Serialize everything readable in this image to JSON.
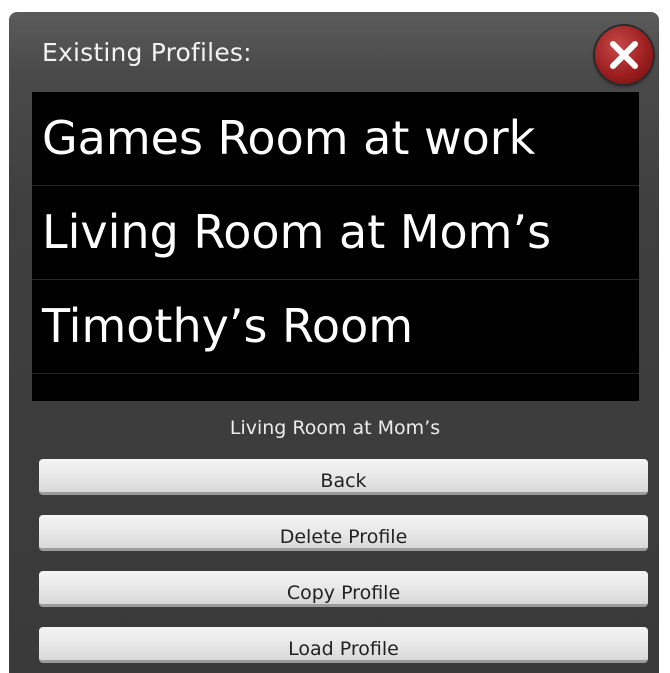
{
  "dialog": {
    "title": "Existing Profiles:",
    "close_icon": "close-icon"
  },
  "profiles": {
    "items": [
      {
        "label": "Games Room at work"
      },
      {
        "label": "Living Room at Mom’s"
      },
      {
        "label": "Timothy’s Room"
      }
    ]
  },
  "selected_profile": "Living Room at Mom’s",
  "buttons": {
    "back": "Back",
    "delete": "Delete Profile",
    "copy": "Copy Profile",
    "load": "Load Profile"
  },
  "colors": {
    "dialog_background": "#4a4a4a",
    "list_background": "#000000",
    "close_button": "#9e1f1f",
    "button_face": "#e6e6e6"
  }
}
